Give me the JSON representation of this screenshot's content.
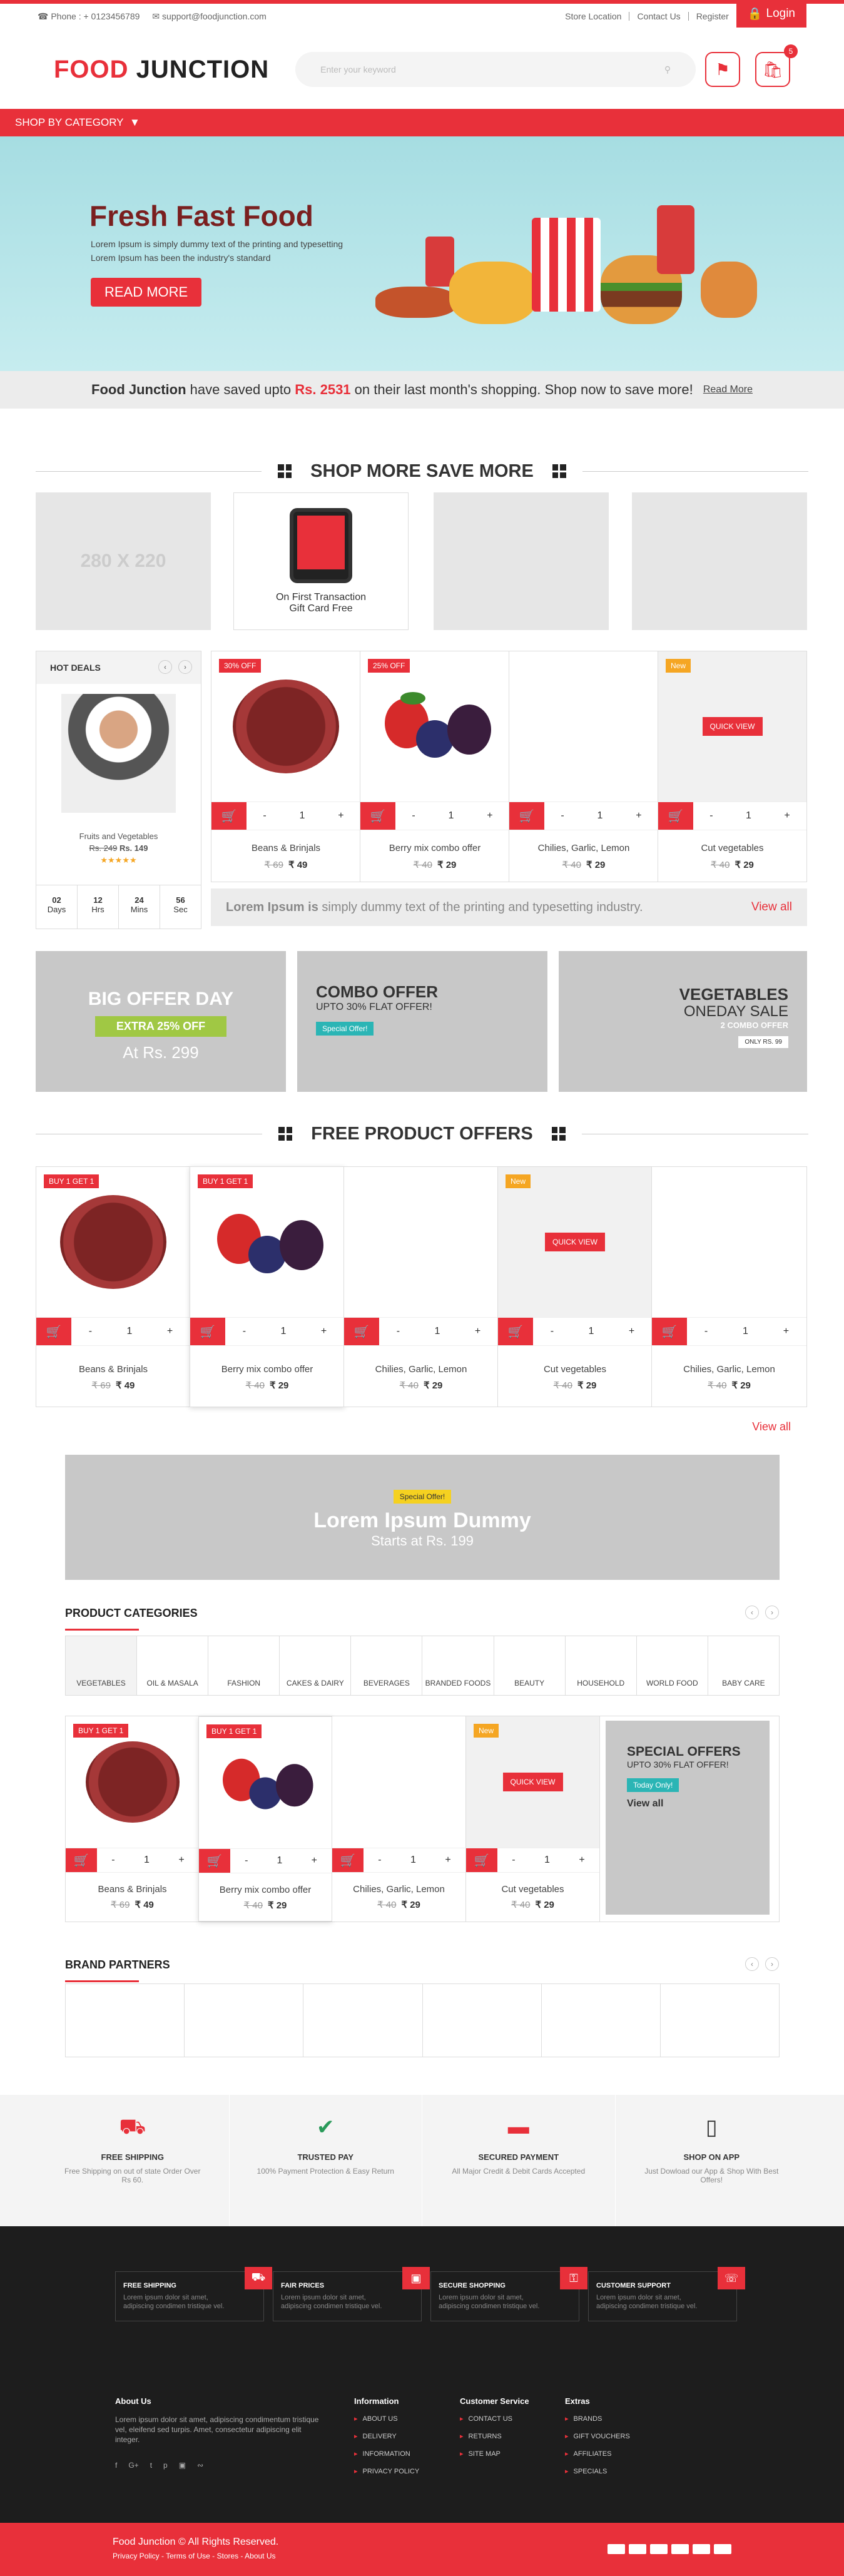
{
  "topbar": {
    "phone": "Phone : + 0123456789",
    "email": "support@foodjunction.com",
    "links": [
      "Store Location",
      "Contact Us",
      "Register"
    ],
    "login": "Login"
  },
  "header": {
    "logo_a": "FOOD",
    "logo_b": "JUNCTION",
    "search_placeholder": "Enter your keyword",
    "cart_count": "5"
  },
  "catbar": {
    "label": "SHOP BY CATEGORY"
  },
  "hero": {
    "title": "Fresh Fast Food",
    "line1": "Lorem Ipsum is simply dummy text of the printing and typesetting",
    "line2": "Lorem Ipsum has been the industry's standard",
    "button": "READ MORE"
  },
  "savings": {
    "brand": "Food Junction",
    "pre": "have saved upto",
    "amount": "Rs. 2531",
    "post": "on their last month's shopping. Shop now to save more!",
    "link": "Read More"
  },
  "shop_more": {
    "title": "SHOP MORE SAVE MORE",
    "ad": "280 X 220",
    "gift1": "On First Transaction",
    "gift2": "Gift Card Free"
  },
  "hot_deals": {
    "title": "HOT DEALS",
    "name": "Fruits and Vegetables",
    "old": "Rs. 249",
    "new": "Rs. 149",
    "stars": "★★★★★",
    "countdown": [
      {
        "n": "02",
        "u": "Days"
      },
      {
        "n": "12",
        "u": "Hrs"
      },
      {
        "n": "24",
        "u": "Mins"
      },
      {
        "n": "56",
        "u": "Sec"
      }
    ]
  },
  "products": [
    {
      "tag": "30% OFF",
      "name": "Beans & Brinjals",
      "old": "₹ 69",
      "price": "₹ 49"
    },
    {
      "tag": "25% OFF",
      "name": "Berry mix combo offer",
      "old": "₹ 40",
      "price": "₹ 29"
    },
    {
      "tag": "",
      "name": "Chilies, Garlic, Lemon",
      "old": "₹ 40",
      "price": "₹ 29"
    },
    {
      "tag": "New",
      "name": "Cut vegetables",
      "old": "₹ 40",
      "price": "₹ 29",
      "quick": "QUICK VIEW"
    }
  ],
  "qty": "1",
  "lorem_bar": {
    "bold": "Lorem Ipsum is",
    "rest": "simply dummy text of the printing and typesetting industry.",
    "link": "View all"
  },
  "offers": {
    "big1": "BIG OFFER DAY",
    "big2": "EXTRA 25% OFF",
    "big3": "At Rs. 299",
    "combo1": "COMBO OFFER",
    "combo2": "UPTO 30% FLAT OFFER!",
    "combo3": "Special Offer!",
    "veg1": "VEGETABLES",
    "veg2": "ONEDAY SALE",
    "veg3": "2 COMBO OFFER",
    "veg4": "ONLY RS. 99"
  },
  "free": {
    "title": "FREE PRODUCT OFFERS",
    "tag": "BUY 1 GET 1",
    "items": [
      {
        "name": "Beans & Brinjals",
        "old": "₹ 69",
        "price": "₹ 49"
      },
      {
        "name": "Berry mix combo offer",
        "old": "₹ 40",
        "price": "₹ 29"
      },
      {
        "name": "Chilies, Garlic, Lemon",
        "old": "₹ 40",
        "price": "₹ 29"
      },
      {
        "name": "Cut vegetables",
        "old": "₹ 40",
        "price": "₹ 29"
      },
      {
        "name": "Chilies, Garlic, Lemon",
        "old": "₹ 40",
        "price": "₹ 29"
      }
    ],
    "view_all": "View all"
  },
  "promo": {
    "tag": "Special Offer!",
    "title": "Lorem Ipsum Dummy",
    "sub": "Starts at Rs. 199"
  },
  "categories": {
    "title": "PRODUCT CATEGORIES",
    "list": [
      "VEGETABLES",
      "OIL & MASALA",
      "FASHION",
      "CAKES & DAIRY",
      "BEVERAGES",
      "BRANDED FOODS",
      "BEAUTY",
      "HOUSEHOLD",
      "WORLD FOOD",
      "BABY CARE"
    ]
  },
  "special": {
    "h": "SPECIAL OFFERS",
    "s": "UPTO 30% FLAT OFFER!",
    "tag": "Today Only!",
    "link": "View all"
  },
  "brands": {
    "title": "BRAND PARTNERS"
  },
  "features": [
    {
      "t": "FREE SHIPPING",
      "d": "Free Shipping on out of state Order Over Rs 60."
    },
    {
      "t": "TRUSTED PAY",
      "d": "100% Payment Protection & Easy Return"
    },
    {
      "t": "SECURED PAYMENT",
      "d": "All Major Credit & Debit Cards Accepted"
    },
    {
      "t": "SHOP ON APP",
      "d": "Just Dowload our App & Shop With Best Offers!"
    }
  ],
  "dark_boxes": [
    {
      "t": "FREE SHIPPING",
      "d": "Lorem ipsum dolor sit amet, adipiscing condimen tristique vel."
    },
    {
      "t": "FAIR PRICES",
      "d": "Lorem ipsum dolor sit amet, adipiscing condimen tristique vel."
    },
    {
      "t": "SECURE SHOPPING",
      "d": "Lorem ipsum dolor sit amet, adipiscing condimen tristique vel."
    },
    {
      "t": "CUSTOMER SUPPORT",
      "d": "Lorem ipsum dolor sit amet, adipiscing condimen tristique vel."
    }
  ],
  "footer": {
    "about_t": "About Us",
    "about": "Lorem ipsum dolor sit amet, adipiscing condimentum tristique vel, eleifend sed turpis. Amet, consectetur adipiscing elit integer.",
    "info_t": "Information",
    "info": [
      "ABOUT US",
      "DELIVERY",
      "INFORMATION",
      "PRIVACY POLICY"
    ],
    "cs_t": "Customer Service",
    "cs": [
      "CONTACT US",
      "RETURNS",
      "SITE MAP"
    ],
    "ex_t": "Extras",
    "ex": [
      "BRANDS",
      "GIFT VOUCHERS",
      "AFFILIATES",
      "SPECIALS"
    ],
    "copy": "Food Junction © All Rights Reserved.",
    "links": "Privacy Policy - Terms of Use - Stores - About Us"
  },
  "colors": {
    "accent": "#e8303a",
    "dark": "#1d1d1d"
  }
}
